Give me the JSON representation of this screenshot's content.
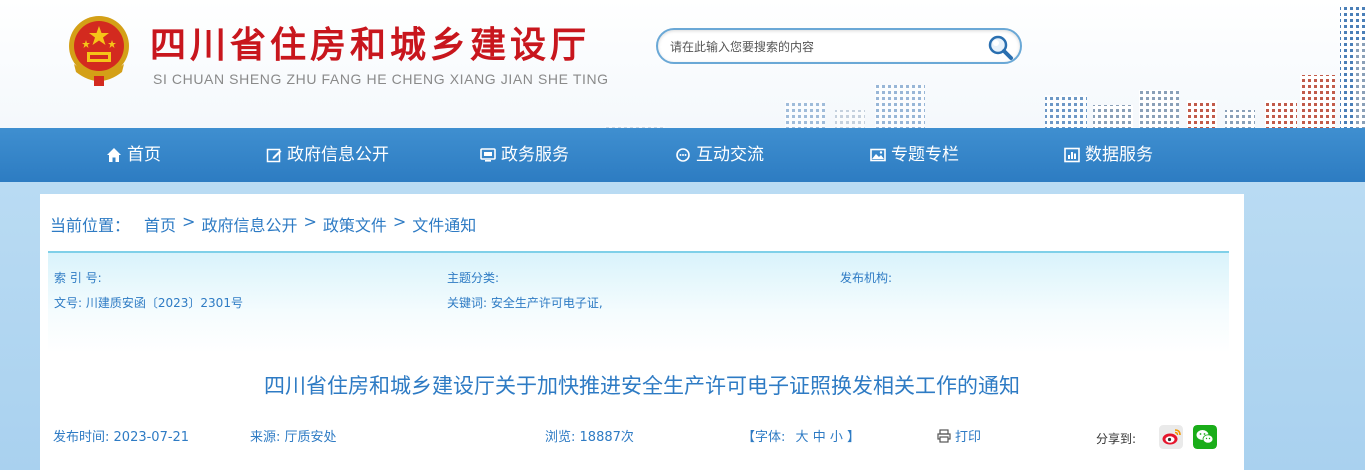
{
  "header": {
    "title": "四川省住房和城乡建设厅",
    "subtitle": "SI CHUAN SHENG ZHU FANG HE CHENG XIANG JIAN SHE TING",
    "search_placeholder": "请在此输入您要搜索的内容"
  },
  "nav": {
    "items": [
      {
        "label": "首页",
        "icon": "home-icon"
      },
      {
        "label": "政府信息公开",
        "icon": "edit-icon"
      },
      {
        "label": "政务服务",
        "icon": "monitor-icon"
      },
      {
        "label": "互动交流",
        "icon": "chat-icon"
      },
      {
        "label": "专题专栏",
        "icon": "image-icon"
      },
      {
        "label": "数据服务",
        "icon": "chart-icon"
      }
    ]
  },
  "breadcrumb": {
    "label": "当前位置：",
    "items": [
      "首页",
      "政府信息公开",
      "政策文件",
      "文件通知"
    ],
    "separator": ">"
  },
  "meta": {
    "index_label": "索 引 号:",
    "index_value": "",
    "category_label": "主题分类:",
    "category_value": "",
    "publisher_label": "发布机构:",
    "publisher_value": "",
    "docno_label": "文号:",
    "docno_value": "川建质安函〔2023〕2301号",
    "keywords_label": "关键词:",
    "keywords_value": "安全生产许可电子证,"
  },
  "document": {
    "title": "四川省住房和城乡建设厅关于加快推进安全生产许可电子证照换发相关工作的通知",
    "publish_label": "发布时间:",
    "publish_date": "2023-07-21",
    "source_label": "来源:",
    "source_value": "厅质安处",
    "views_label": "浏览:",
    "views_value": "18887次",
    "font_label": "【字体:",
    "font_large": "大",
    "font_medium": "中",
    "font_small": "小",
    "font_close": "】",
    "print_label": "打印",
    "share_label": "分享到:"
  },
  "colors": {
    "brand_red": "#c8161d",
    "nav_blue": "#2d7cc2",
    "link_blue": "#2e7bc4"
  }
}
